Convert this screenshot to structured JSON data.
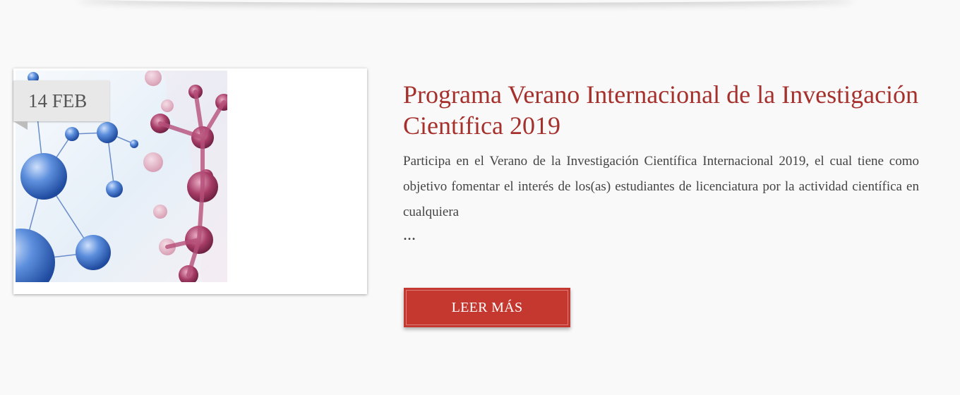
{
  "post": {
    "date": "14 FEB",
    "title": "Programa Verano Internacional de la Investigación Científica 2019",
    "excerpt": "Participa en el Verano de la Investigación Científica Internacional 2019, el cual tiene como objetivo fomentar el interés de los(as) estudiantes de licenciatura por la actividad científica en cualquiera",
    "ellipsis": "...",
    "read_more_label": "LEER MÁS",
    "image_icon": "molecule-illustration-icon"
  },
  "colors": {
    "accent": "#a5302c",
    "button": "#c4382f",
    "background": "#f9f9f9",
    "molecule_blue": "#3d6fc4",
    "molecule_magenta": "#8e2451"
  }
}
